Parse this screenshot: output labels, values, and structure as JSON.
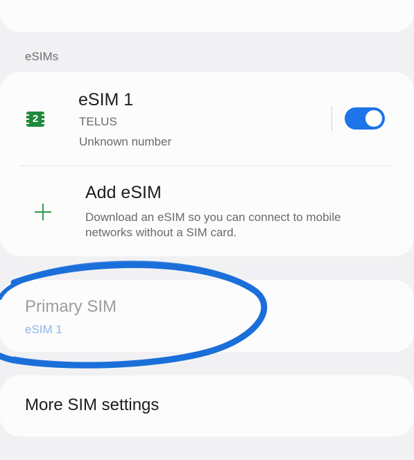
{
  "section_label": "eSIMs",
  "esim": {
    "icon": "sim-card-icon",
    "slot_number": "2",
    "title": "eSIM 1",
    "carrier": "TELUS",
    "number": "Unknown number",
    "toggle_on": true
  },
  "add_esim": {
    "icon": "plus-icon",
    "title": "Add eSIM",
    "description": "Download an eSIM so you can connect to mobile networks without a SIM card."
  },
  "primary_sim": {
    "title": "Primary SIM",
    "value": "eSIM 1"
  },
  "more_sim_settings": {
    "title": "More SIM settings"
  },
  "colors": {
    "accent": "#1c74e8",
    "sim_icon": "#1f8a3a",
    "plus_icon": "#2e9a4b",
    "annotation": "#1a6fd9",
    "background": "#f1f1f3",
    "card": "#fcfcfc"
  }
}
